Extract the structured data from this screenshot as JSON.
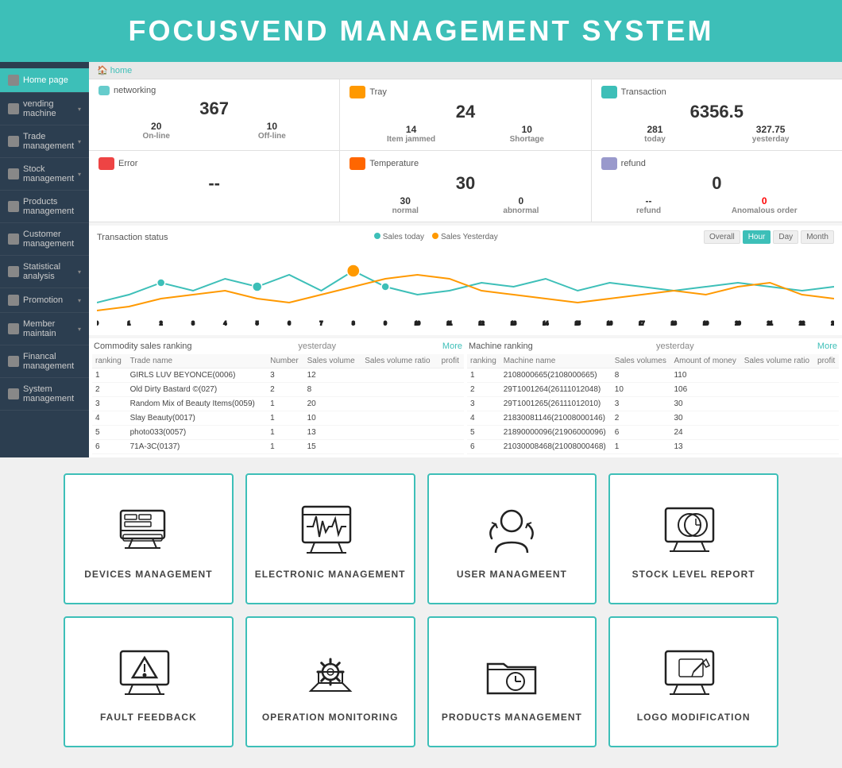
{
  "header": {
    "title": "FOCUSVEND MANAGEMENT SYSTEM"
  },
  "sidebar": {
    "items": [
      {
        "label": "Home page",
        "active": true,
        "hasArrow": false
      },
      {
        "label": "vending machine",
        "active": false,
        "hasArrow": true
      },
      {
        "label": "Trade management",
        "active": false,
        "hasArrow": true
      },
      {
        "label": "Stock management",
        "active": false,
        "hasArrow": true
      },
      {
        "label": "Products management",
        "active": false,
        "hasArrow": false
      },
      {
        "label": "Customer management",
        "active": false,
        "hasArrow": false
      },
      {
        "label": "Statistical analysis",
        "active": false,
        "hasArrow": true
      },
      {
        "label": "Promotion",
        "active": false,
        "hasArrow": true
      },
      {
        "label": "Member maintain",
        "active": false,
        "hasArrow": true
      },
      {
        "label": "Financal management",
        "active": false,
        "hasArrow": false
      },
      {
        "label": "System management",
        "active": false,
        "hasArrow": false
      }
    ]
  },
  "breadcrumb": "home",
  "stats": {
    "networking": {
      "label": "networking",
      "total": "367",
      "online_label": "On-line",
      "online_val": "20",
      "offline_label": "Off-line",
      "offline_val": "10"
    },
    "tray": {
      "label": "Tray",
      "total": "24",
      "jammed_label": "Item jammed",
      "jammed_val": "14",
      "shortage_label": "Shortage",
      "shortage_val": "10"
    },
    "transaction": {
      "label": "Transaction",
      "total": "6356.5",
      "today_label": "today",
      "today_val": "281",
      "yesterday_label": "yesterday",
      "yesterday_val": "327.75"
    },
    "error": {
      "label": "Error",
      "total": "--"
    },
    "temperature": {
      "label": "Temperature",
      "total": "30",
      "normal_label": "normal",
      "normal_val": "30",
      "abnormal_label": "abnormal",
      "abnormal_val": "0"
    },
    "refund": {
      "label": "refund",
      "total": "0",
      "refund_label": "refund",
      "refund_val": "--",
      "anomalous_label": "Anomalous order",
      "anomalous_val": "0"
    }
  },
  "chart": {
    "header_label": "Transaction status",
    "legend_today": "Sales today",
    "legend_yesterday": "Sales Yesterday",
    "tabs": [
      "Overall",
      "Hour",
      "Day",
      "Month"
    ],
    "active_tab": "Hour"
  },
  "commodity_table": {
    "title": "Commodity sales ranking",
    "yesterday_label": "yesterday",
    "more_label": "More",
    "columns": [
      "ranking",
      "Trade name",
      "Number",
      "Sales volume",
      "Sales volume ratio",
      "profit"
    ],
    "rows": [
      [
        "1",
        "GIRLS LUV BEYONCE(0006)",
        "3",
        "12",
        "",
        ""
      ],
      [
        "2",
        "Old Dirty Bastard ©(027)",
        "2",
        "8",
        "",
        ""
      ],
      [
        "3",
        "Random Mix of Beauty Items(0059)",
        "1",
        "20",
        "",
        ""
      ],
      [
        "4",
        "Slay Beauty(0017)",
        "1",
        "10",
        "",
        ""
      ],
      [
        "5",
        "photo033(0057)",
        "1",
        "13",
        "",
        ""
      ],
      [
        "6",
        "71A-3C(0137)",
        "1",
        "15",
        "",
        ""
      ]
    ]
  },
  "machine_table": {
    "title": "Machine ranking",
    "yesterday_label": "yesterday",
    "more_label": "More",
    "columns": [
      "ranking",
      "Machine name",
      "Sales volumes",
      "Amount of money",
      "Sales volume ratio",
      "profit"
    ],
    "rows": [
      [
        "1",
        "2108000665(2108000665)",
        "8",
        "110",
        "",
        ""
      ],
      [
        "2",
        "29T1001264(26111012048)",
        "10",
        "106",
        "",
        ""
      ],
      [
        "3",
        "29T1001265(26111012010)",
        "3",
        "30",
        "",
        ""
      ],
      [
        "4",
        "21830081146(21008000146)",
        "2",
        "30",
        "",
        ""
      ],
      [
        "5",
        "21890000096(21906000096)",
        "6",
        "24",
        "",
        ""
      ],
      [
        "6",
        "21030008468(21008000468)",
        "1",
        "13",
        "",
        ""
      ]
    ]
  },
  "cards": {
    "row1": [
      {
        "id": "devices-management",
        "label": "DEVICES MANAGEMENT"
      },
      {
        "id": "electronic-management",
        "label": "ELECTRONIC MANAGEMENT"
      },
      {
        "id": "user-management",
        "label": "USER MANAGMEENT"
      },
      {
        "id": "stock-level-report",
        "label": "STOCK LEVEL REPORT"
      }
    ],
    "row2": [
      {
        "id": "fault-feedback",
        "label": "FAULT FEEDBACK"
      },
      {
        "id": "operation-monitoring",
        "label": "OPERATION MONITORING"
      },
      {
        "id": "products-management",
        "label": "PRODUCTS MANAGEMENT"
      },
      {
        "id": "logo-modification",
        "label": "LOGO MODIFICATION"
      }
    ]
  }
}
